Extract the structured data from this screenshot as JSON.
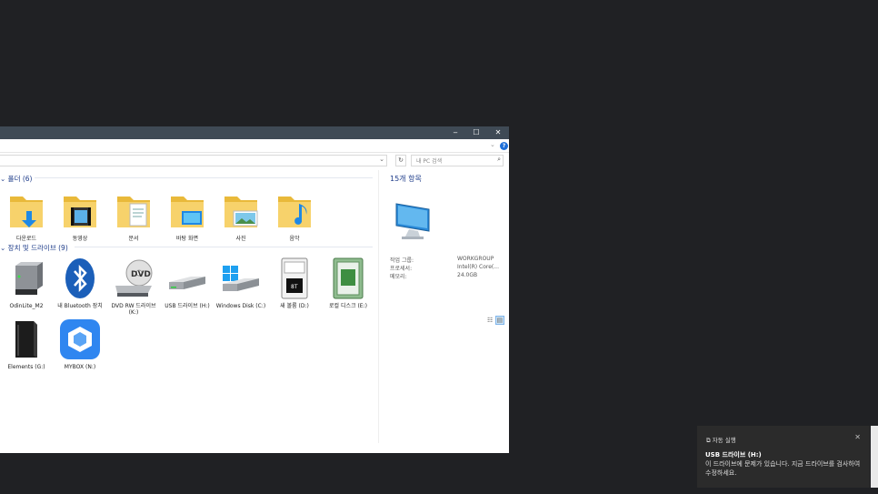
{
  "window": {
    "controls": {
      "minimize": "‒",
      "maximize": "☐",
      "close": "✕"
    },
    "help": "?",
    "search_placeholder": "내 PC 검색"
  },
  "folders_group": {
    "title": "폴더 (6)",
    "items": [
      {
        "label": "다운로드",
        "icon": "downloads-folder-icon"
      },
      {
        "label": "동영상",
        "icon": "videos-folder-icon"
      },
      {
        "label": "문서",
        "icon": "documents-folder-icon"
      },
      {
        "label": "바탕 화면",
        "icon": "desktop-folder-icon"
      },
      {
        "label": "사진",
        "icon": "pictures-folder-icon"
      },
      {
        "label": "음악",
        "icon": "music-folder-icon"
      }
    ]
  },
  "drives_group": {
    "title": "장치 및 드라이브 (9)",
    "items": [
      {
        "label": "OdinLite_M2",
        "icon": "external-drive-icon"
      },
      {
        "label": "내 Bluetooth 장치",
        "icon": "bluetooth-icon"
      },
      {
        "label": "DVD RW 드라이브 (K:)",
        "icon": "dvd-drive-icon"
      },
      {
        "label": "USB 드라이브 (H:)",
        "icon": "usb-drive-icon"
      },
      {
        "label": "Windows Disk (C:)",
        "icon": "windows-disk-icon"
      },
      {
        "label": "새 볼륨 (D:)",
        "icon": "hdd-icon"
      },
      {
        "label": "로컬 디스크 (E:)",
        "icon": "hdd-green-icon"
      },
      {
        "label": "Elements (G:)",
        "icon": "elements-drive-icon"
      },
      {
        "label": "MYBOX (N:)",
        "icon": "mybox-icon"
      }
    ]
  },
  "details": {
    "title": "15개 항목",
    "rows": [
      {
        "key": "작업 그룹:",
        "value": "WORKGROUP"
      },
      {
        "key": "프로세서:",
        "value": "Intel(R) Core(..."
      },
      {
        "key": "메모리:",
        "value": "24.0GB"
      }
    ]
  },
  "toast": {
    "app": "자동 실행",
    "title": "USB 드라이브 (H:)",
    "body": "이 드라이브에 문제가 있습니다. 지금 드라이브를 검사하여 수정하세요."
  }
}
